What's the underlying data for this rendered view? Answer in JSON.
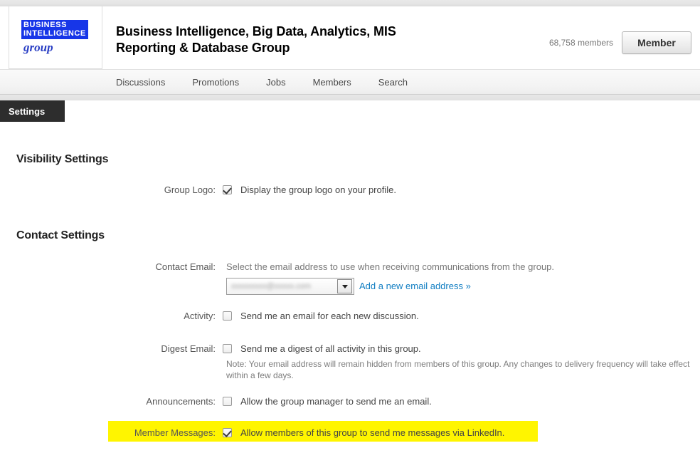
{
  "header": {
    "logo": {
      "line1": "BUSINESS",
      "line2": "INTELLIGENCE",
      "line3": "group",
      "band_color": "#1736e8",
      "script_color": "#2a3fc4"
    },
    "group_title": "Business Intelligence, Big Data, Analytics, MIS Reporting & Database Group",
    "members_count": "68,758 members",
    "member_button": "Member"
  },
  "nav": {
    "items": [
      {
        "label": "Discussions"
      },
      {
        "label": "Promotions"
      },
      {
        "label": "Jobs"
      },
      {
        "label": "Members"
      },
      {
        "label": "Search"
      }
    ]
  },
  "settings_tab": {
    "label": "Settings",
    "background": "#2d2d2d"
  },
  "sections": [
    {
      "title": "Visibility Settings",
      "rows": [
        {
          "label": "Group Logo:",
          "checked": true,
          "text": "Display the group logo on your profile."
        }
      ]
    },
    {
      "title": "Contact Settings",
      "rows": [
        {
          "label": "Contact Email:",
          "helper": "Select the email address to use when receiving communications from the group.",
          "select_value": "xxxxxxxxx@xxxxx.com",
          "link": "Add a new email address »"
        },
        {
          "label": "Activity:",
          "checked": false,
          "text": "Send me an email for each new discussion."
        },
        {
          "label": "Digest Email:",
          "checked": false,
          "text": "Send me a digest of all activity in this group.",
          "note": "Note: Your email address will remain hidden from members of this group. Any changes to delivery frequency will take effect within a few days."
        },
        {
          "label": "Announcements:",
          "checked": false,
          "text": "Allow the group manager to send me an email."
        },
        {
          "label": "Member Messages:",
          "checked": true,
          "text": "Allow members of this group to send me messages via LinkedIn.",
          "highlighted": true,
          "highlight_color": "#fff500"
        }
      ]
    }
  ]
}
